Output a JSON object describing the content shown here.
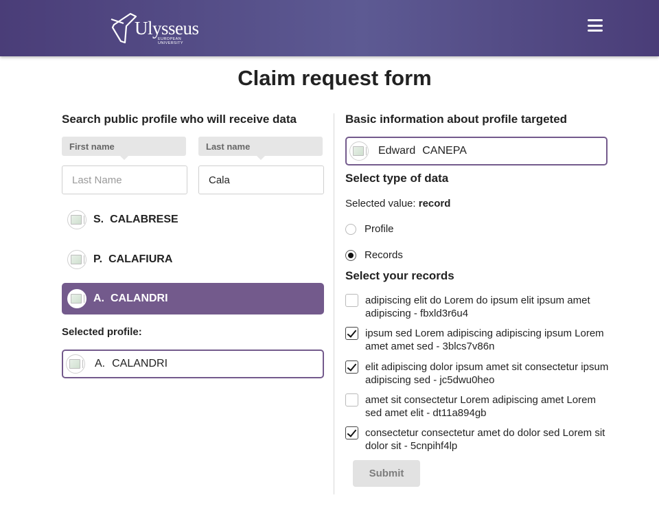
{
  "header": {
    "logo_text": "Ulysseus",
    "logo_subtext": "EUROPEAN UNIVERSITY",
    "logo_icon": "star-outline-icon",
    "menu_icon": "hamburger-menu-icon"
  },
  "page_title": "Claim request form",
  "left": {
    "heading": "Search public profile who will receive data",
    "first_name_label": "First name",
    "last_name_label": "Last name",
    "first_name_input": {
      "value": "",
      "placeholder": "Last Name"
    },
    "last_name_input": {
      "value": "Cala",
      "placeholder": ""
    },
    "results": [
      {
        "initial": "S.",
        "surname": "CALABRESE",
        "active": false
      },
      {
        "initial": "P.",
        "surname": "CALAFIURA",
        "active": false
      },
      {
        "initial": "A.",
        "surname": "CALANDRI",
        "active": true
      }
    ],
    "selected_label": "Selected profile:",
    "selected_profile": {
      "initial": "A.",
      "surname": "CALANDRI"
    }
  },
  "right": {
    "heading": "Basic information about profile targeted",
    "target_profile": {
      "first": "Edward",
      "last": "CANEPA"
    },
    "type_heading": "Select type of data",
    "selected_value_label": "Selected value:",
    "selected_value": "record",
    "options": [
      {
        "label": "Profile",
        "checked": false
      },
      {
        "label": "Records",
        "checked": true
      }
    ],
    "records_heading": "Select your records",
    "records": [
      {
        "label": "adipiscing elit do Lorem do ipsum elit ipsum amet adipiscing - fbxld3r6u4",
        "checked": false
      },
      {
        "label": "ipsum sed Lorem adipiscing adipiscing ipsum Lorem amet amet sed - 3blcs7v86n",
        "checked": true
      },
      {
        "label": "elit adipiscing dolor ipsum amet sit consectetur ipsum adipiscing sed - jc5dwu0heo",
        "checked": true
      },
      {
        "label": "amet sit consectetur Lorem adipiscing amet Lorem sed amet elit - dt11a894gb",
        "checked": false
      },
      {
        "label": "consectetur consectetur amet do dolor sed Lorem sit dolor sit - 5cnpihf4lp",
        "checked": true
      }
    ],
    "submit_label": "Submit"
  },
  "colors": {
    "header_bg": "#4a3d78",
    "accent": "#735a8c",
    "submit_bg": "#e2e2e2"
  }
}
